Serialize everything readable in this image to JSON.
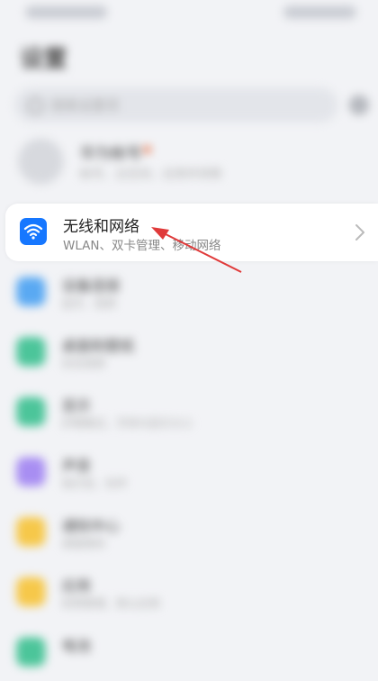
{
  "status_bar": {
    "left": "",
    "right": ""
  },
  "page": {
    "title": "设置"
  },
  "search": {
    "placeholder": "搜索设置项"
  },
  "account": {
    "name": "华为帐号",
    "sub": "帐号、云空间、应用市场等"
  },
  "wlan_item": {
    "title": "无线和网络",
    "subtitle": "WLAN、双卡管理、移动网络",
    "icon": "wifi-icon",
    "accent": "#1677ff"
  },
  "items": [
    {
      "title": "设备连接",
      "sub": "蓝牙、投屏",
      "color": "#5aa9f2"
    },
    {
      "title": "桌面和壁纸",
      "sub": "杂志锁屏",
      "color": "#4cc59a"
    },
    {
      "title": "显示",
      "sub": "护眼模式、字体与显示大小",
      "color": "#4cc59a"
    },
    {
      "title": "声音",
      "sub": "免打扰、铃声",
      "color": "#a88ef2"
    },
    {
      "title": "通知中心",
      "sub": "桌面角标",
      "color": "#f6c84a"
    },
    {
      "title": "应用",
      "sub": "权限管理、默认应用",
      "color": "#f6c84a"
    },
    {
      "title": "电池",
      "sub": "",
      "color": "#4cc59a"
    }
  ],
  "annotation": {
    "arrow_color": "#e03a3a"
  }
}
